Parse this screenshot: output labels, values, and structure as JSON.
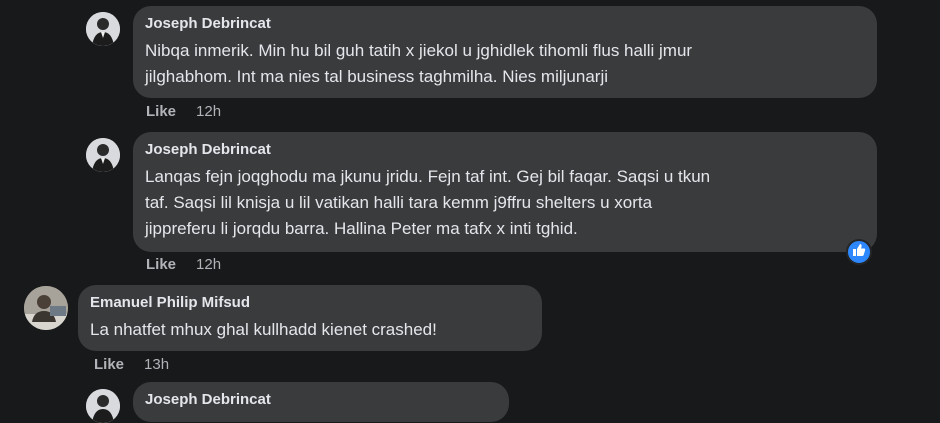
{
  "comments": [
    {
      "author": "Joseph Debrincat",
      "text": "Nibqa inmerik. Min hu bil guh tatih x jiekol u jghidlek tihomli flus halli jmur\njilghabhom. Int ma nies tal business taghmilha. Nies miljunarji",
      "like_label": "Like",
      "time": "12h"
    },
    {
      "author": "Joseph Debrincat",
      "text": "Lanqas fejn joqghodu ma jkunu jridu. Fejn taf int. Gej bil faqar. Saqsi u tkun\ntaf. Saqsi lil knisja u lil vatikan halli tara kemm j9ffru shelters u xorta\njippreferu li jorqdu barra. Hallina Peter ma tafx x inti tghid.",
      "like_label": "Like",
      "time": "12h",
      "reaction": "like-icon"
    },
    {
      "author": "Emanuel Philip Mifsud",
      "text": "La nhatfet mhux ghal kullhadd kienet crashed!",
      "like_label": "Like",
      "time": "13h"
    },
    {
      "author": "Joseph Debrincat"
    }
  ],
  "colors": {
    "background": "#18191a",
    "bubble": "#3a3b3c",
    "meta": "#b0b3b8",
    "reaction": "#2d88ff"
  }
}
